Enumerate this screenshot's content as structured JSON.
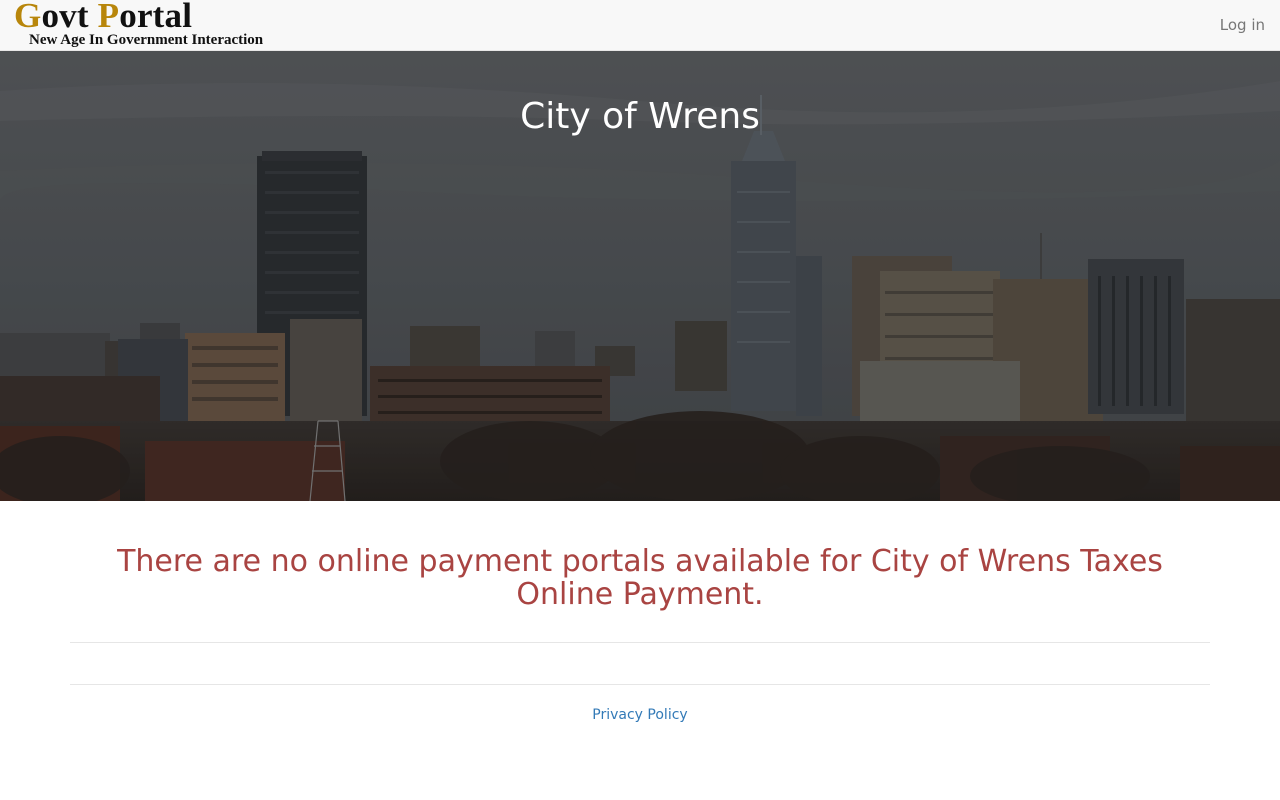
{
  "navbar": {
    "brand_letter_1": "G",
    "brand_word_1": "ovt ",
    "brand_letter_2": "P",
    "brand_word_2": "ortal",
    "tagline": "New Age In Government Interaction",
    "login_label": "Log in"
  },
  "hero": {
    "title": "City of Wrens"
  },
  "main": {
    "message": "There are no online payment portals available for City of Wrens Taxes Online Payment."
  },
  "footer": {
    "privacy_label": "Privacy Policy"
  },
  "colors": {
    "brand_accent": "#b8860b",
    "alert_text": "#a94442",
    "link": "#337ab7",
    "navbar_bg": "#f8f8f8"
  }
}
